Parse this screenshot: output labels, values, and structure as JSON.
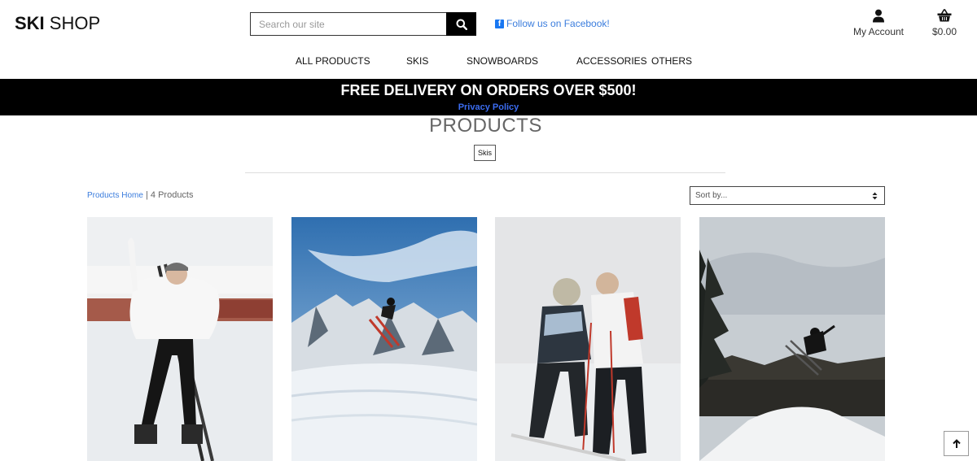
{
  "header": {
    "logo_bold": "SKI",
    "logo_rest": " SHOP",
    "search_placeholder": "Search our site",
    "facebook_label": "Follow us on Facebook!",
    "account_label": "My Account",
    "bag_total": "$0.00"
  },
  "nav": {
    "all_products": "ALL PRODUCTS",
    "skis": "SKIS",
    "snowboards": "SNOWBOARDS",
    "accessories": "ACCESSORIES",
    "others": "OTHERS"
  },
  "banner": {
    "text": "FREE DELIVERY ON ORDERS OVER $500!",
    "link": "Privacy Policy"
  },
  "main": {
    "heading": "PRODUCTS",
    "category_tag": "Skis",
    "breadcrumb_link": "Products Home",
    "breadcrumb_separator": " | ",
    "product_count": "4 Products",
    "sort_selected": "Sort by..."
  },
  "products": [
    {
      "image": "woman-holding-skis"
    },
    {
      "image": "skier-jumping-over-mountains"
    },
    {
      "image": "ski-instructor-helping-child"
    },
    {
      "image": "skier-jumping-off-snow-ramp"
    }
  ],
  "colors": {
    "link": "#3b7ddd",
    "banner_bg": "#000000",
    "banner_text": "#ffffff",
    "banner_link": "#3b6cf0"
  }
}
